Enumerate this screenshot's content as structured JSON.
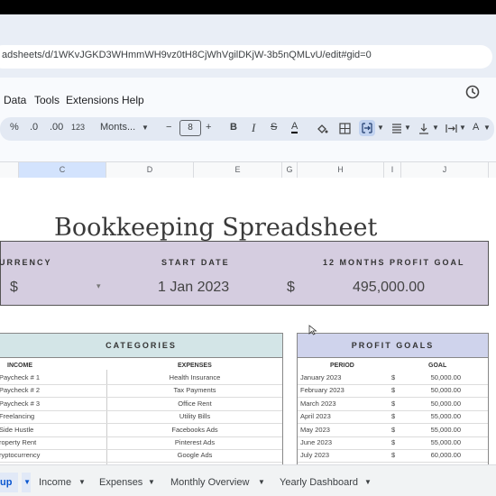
{
  "browser": {
    "url": "adsheets/d/1WKvJGKD3WHmmWH9vz0tH8CjWhVgilDKjW-3b5nQMLvU/edit#gid=0"
  },
  "menu": {
    "items": [
      "Data",
      "Tools",
      "Extensions",
      "Help"
    ]
  },
  "toolbar": {
    "percent": "%",
    "dec_decrease": ".0",
    "dec_increase": ".00",
    "format_123": "123",
    "font": "Monts...",
    "minus": "−",
    "font_size": "8",
    "plus": "+",
    "bold": "B",
    "italic": "I",
    "strike": "S",
    "text_color": "A"
  },
  "columns": [
    "C",
    "D",
    "E",
    "G",
    "H",
    "I",
    "J"
  ],
  "sheet": {
    "title": "Bookkeeping Spreadsheet",
    "currency_label": "URRENCY",
    "currency_value": "$",
    "start_date_label": "START DATE",
    "start_date_value": "1 Jan 2023",
    "goal_label": "12 MONTHS PROFIT GOAL",
    "goal_currency": "$",
    "goal_value": "495,000.00"
  },
  "categories": {
    "title": "CATEGORIES",
    "income_header": "INCOME",
    "expenses_header": "EXPENSES",
    "rows": [
      {
        "income": "Paycheck # 1",
        "expense": "Health Insurance"
      },
      {
        "income": "Paycheck # 2",
        "expense": "Tax Payments"
      },
      {
        "income": "Paycheck # 3",
        "expense": "Office Rent"
      },
      {
        "income": "Freelancing",
        "expense": "Utility Bills"
      },
      {
        "income": "Side Hustle",
        "expense": "Facebooks Ads"
      },
      {
        "income": "roperty Rent",
        "expense": "Pinterest Ads"
      },
      {
        "income": "ryptocurrency",
        "expense": "Google Ads"
      }
    ]
  },
  "profit_goals": {
    "title": "PROFIT GOALS",
    "period_header": "PERIOD",
    "goal_header": "GOAL",
    "rows": [
      {
        "period": "January 2023",
        "cur": "$",
        "goal": "50,000.00"
      },
      {
        "period": "February 2023",
        "cur": "$",
        "goal": "50,000.00"
      },
      {
        "period": "March 2023",
        "cur": "$",
        "goal": "50,000.00"
      },
      {
        "period": "April 2023",
        "cur": "$",
        "goal": "55,000.00"
      },
      {
        "period": "May 2023",
        "cur": "$",
        "goal": "55,000.00"
      },
      {
        "period": "June 2023",
        "cur": "$",
        "goal": "55,000.00"
      },
      {
        "period": "July 2023",
        "cur": "$",
        "goal": "60,000.00"
      }
    ]
  },
  "tabs": [
    "up",
    "Income",
    "Expenses",
    "Monthly Overview",
    "Yearly Dashboard"
  ],
  "colors": {
    "band": "#d5cde0",
    "categories_header": "#d3e5e7",
    "profit_header": "#cfd3ec",
    "active_tab": "#0b57d0"
  }
}
